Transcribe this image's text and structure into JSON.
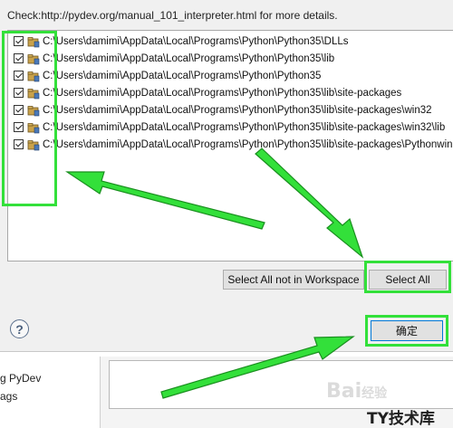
{
  "dialog": {
    "header_text": "Check:http://pydev.org/manual_101_interpreter.html for more details."
  },
  "paths": [
    {
      "label": "C:\\Users\\damimi\\AppData\\Local\\Programs\\Python\\Python35\\DLLs",
      "checked": true
    },
    {
      "label": "C:\\Users\\damimi\\AppData\\Local\\Programs\\Python\\Python35\\lib",
      "checked": true
    },
    {
      "label": "C:\\Users\\damimi\\AppData\\Local\\Programs\\Python\\Python35",
      "checked": true
    },
    {
      "label": "C:\\Users\\damimi\\AppData\\Local\\Programs\\Python\\Python35\\lib\\site-packages",
      "checked": true
    },
    {
      "label": "C:\\Users\\damimi\\AppData\\Local\\Programs\\Python\\Python35\\lib\\site-packages\\win32",
      "checked": true
    },
    {
      "label": "C:\\Users\\damimi\\AppData\\Local\\Programs\\Python\\Python35\\lib\\site-packages\\win32\\lib",
      "checked": true
    },
    {
      "label": "C:\\Users\\damimi\\AppData\\Local\\Programs\\Python\\Python35\\lib\\site-packages\\Pythonwin",
      "checked": true
    }
  ],
  "buttons": {
    "select_all_not_in_workspace": "Select All not in Workspace",
    "select_all": "Select All",
    "ok": "确定",
    "help": "?"
  },
  "background_panel": {
    "items": [
      "g PyDev",
      "ags"
    ]
  },
  "watermark": {
    "baidu": "Bai",
    "baidu_suffix": "经验",
    "site": "TY技术库"
  },
  "colors": {
    "highlight": "#33e03a",
    "ok_button_border": "#0078d7"
  }
}
